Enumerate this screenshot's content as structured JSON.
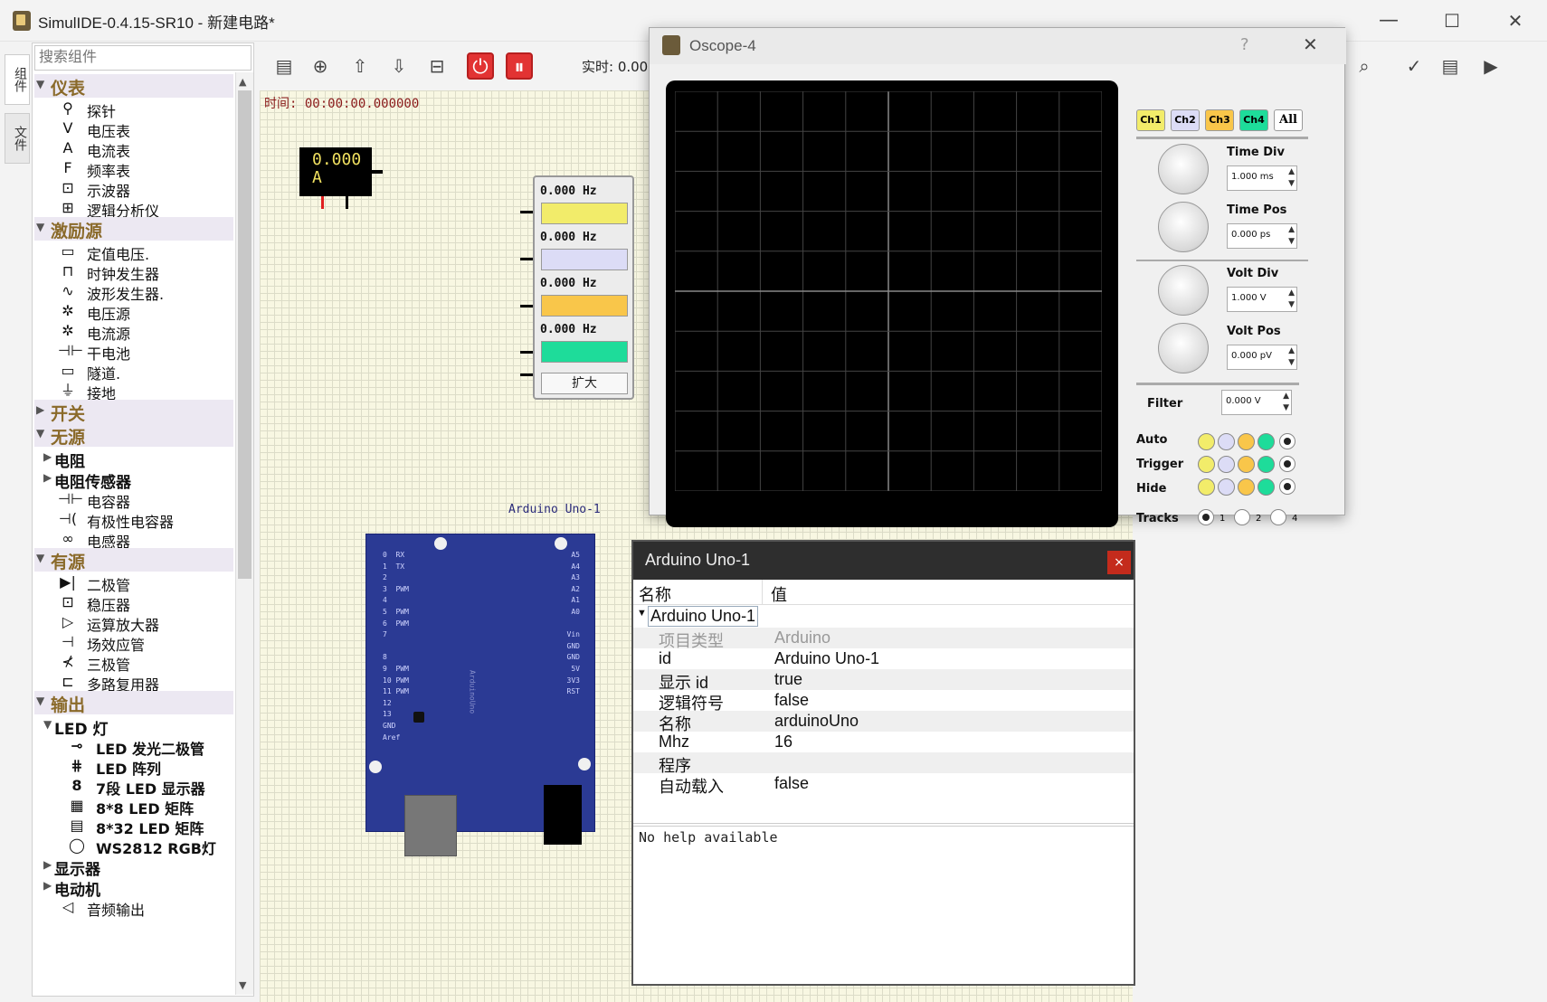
{
  "window": {
    "title": "SimulIDE-0.4.15-SR10  -  新建电路*",
    "min": "—",
    "max": "☐",
    "close": "✕"
  },
  "sidetabs": {
    "components": "组件",
    "files": "文件"
  },
  "components": {
    "search_placeholder": "搜索组件",
    "tree": [
      {
        "kind": "cat",
        "label": "仪表",
        "arrow": "▼"
      },
      {
        "kind": "item",
        "label": "探针",
        "icon": "⚲"
      },
      {
        "kind": "item",
        "label": "电压表",
        "icon": "V"
      },
      {
        "kind": "item",
        "label": "电流表",
        "icon": "A"
      },
      {
        "kind": "item",
        "label": "频率表",
        "icon": "F"
      },
      {
        "kind": "item",
        "label": "示波器",
        "icon": "⊡"
      },
      {
        "kind": "item",
        "label": "逻辑分析仪",
        "icon": "⊞"
      },
      {
        "kind": "cat",
        "label": "激励源",
        "arrow": "▼"
      },
      {
        "kind": "item",
        "label": "定值电压.",
        "icon": "▭"
      },
      {
        "kind": "item",
        "label": "时钟发生器",
        "icon": "⊓"
      },
      {
        "kind": "item",
        "label": "波形发生器.",
        "icon": "∿"
      },
      {
        "kind": "item",
        "label": "电压源",
        "icon": "✲"
      },
      {
        "kind": "item",
        "label": "电流源",
        "icon": "✲"
      },
      {
        "kind": "item",
        "label": "干电池",
        "icon": "⊣⊢"
      },
      {
        "kind": "item",
        "label": "隧道.",
        "icon": "▭"
      },
      {
        "kind": "item",
        "label": "接地",
        "icon": "⏚"
      },
      {
        "kind": "cat",
        "label": "开关",
        "arrow": "▶"
      },
      {
        "kind": "cat",
        "label": "无源",
        "arrow": "▼"
      },
      {
        "kind": "sub",
        "label": "电阻",
        "arrow": "▶"
      },
      {
        "kind": "sub",
        "label": "电阻传感器",
        "arrow": "▶"
      },
      {
        "kind": "item",
        "label": "电容器",
        "icon": "⊣⊢"
      },
      {
        "kind": "item",
        "label": "有极性电容器",
        "icon": "⊣("
      },
      {
        "kind": "item",
        "label": "电感器",
        "icon": "∞"
      },
      {
        "kind": "cat",
        "label": "有源",
        "arrow": "▼"
      },
      {
        "kind": "item",
        "label": "二极管",
        "icon": "▶|"
      },
      {
        "kind": "item",
        "label": "稳压器",
        "icon": "⊡"
      },
      {
        "kind": "item",
        "label": "运算放大器",
        "icon": "▷"
      },
      {
        "kind": "item",
        "label": "场效应管",
        "icon": "⊣"
      },
      {
        "kind": "item",
        "label": "三极管",
        "icon": "⊀"
      },
      {
        "kind": "item",
        "label": "多路复用器",
        "icon": "⊏"
      },
      {
        "kind": "cat",
        "label": "输出",
        "arrow": "▼"
      },
      {
        "kind": "sub",
        "label": "LED 灯",
        "arrow": "▼"
      },
      {
        "kind": "item2",
        "label": "LED 发光二极管",
        "icon": "⊸"
      },
      {
        "kind": "item2",
        "label": "LED 阵列",
        "icon": "⋕"
      },
      {
        "kind": "item2",
        "label": "7段 LED 显示器",
        "icon": "8"
      },
      {
        "kind": "item2",
        "label": "8*8 LED 矩阵",
        "icon": "▦"
      },
      {
        "kind": "item2",
        "label": "8*32 LED 矩阵",
        "icon": "▤"
      },
      {
        "kind": "item2",
        "label": "WS2812 RGB灯",
        "icon": "◯"
      },
      {
        "kind": "sub",
        "label": "显示器",
        "arrow": "▶"
      },
      {
        "kind": "sub",
        "label": "电动机",
        "arrow": "▶"
      },
      {
        "kind": "item",
        "label": "音频输出",
        "icon": "◁"
      }
    ]
  },
  "toolbar": {
    "realtime": "实时: 0.00 %"
  },
  "canvas": {
    "time": "时间:  00:00:00.000000",
    "ammeter_value": "0.000",
    "ammeter_unit": "A",
    "arduino_label": "Arduino Uno-1"
  },
  "freqmeter": {
    "rows": [
      "0.000 Hz",
      "0.000 Hz",
      "0.000 Hz",
      "0.000 Hz"
    ],
    "colors": [
      "#f2ec6a",
      "#dcdcf6",
      "#f9c64a",
      "#1edc9a"
    ],
    "expand": "扩大"
  },
  "arduino": {
    "left_pins": "0  RX\n1  TX\n2\n3  PWM\n4\n5  PWM\n6  PWM\n7\n\n8\n9  PWM\n10 PWM\n11 PWM\n12\n13\nGND\nAref",
    "right_pins": "A5\nA4\nA3\nA2\nA1\nA0\n\nVin\nGND\nGND\n5V\n3V3\nRST",
    "board_text": "ArduinoUno"
  },
  "oscope": {
    "title": "Oscope-4",
    "help": "?",
    "close": "✕",
    "channels": [
      "Ch1",
      "Ch2",
      "Ch3",
      "Ch4",
      "All"
    ],
    "channel_colors": [
      "#f2ec6a",
      "#dcdcf6",
      "#f9c64a",
      "#1edc9a",
      "#ffffff"
    ],
    "time_div": {
      "label": "Time Div",
      "value": "1.000 ms"
    },
    "time_pos": {
      "label": "Time Pos",
      "value": "0.000 ps"
    },
    "volt_div": {
      "label": "Volt Div",
      "value": "1.000 V"
    },
    "volt_pos": {
      "label": "Volt Pos",
      "value": "0.000 pV"
    },
    "filter": {
      "label": "Filter",
      "value": "0.000 V"
    },
    "auto": "Auto",
    "trigger": "Trigger",
    "hide": "Hide",
    "tracks": {
      "label": "Tracks",
      "options": [
        "1",
        "2",
        "4"
      ],
      "selected": "1"
    }
  },
  "props": {
    "title": "Arduino Uno-1",
    "close": "×",
    "col_name": "名称",
    "col_value": "值",
    "group": "Arduino Uno-1",
    "rows": [
      {
        "k": "项目类型",
        "v": "Arduino"
      },
      {
        "k": "id",
        "v": "Arduino Uno-1"
      },
      {
        "k": "显示 id",
        "v": "true"
      },
      {
        "k": "逻辑符号",
        "v": "false"
      },
      {
        "k": "名称",
        "v": "arduinoUno"
      },
      {
        "k": "Mhz",
        "v": "16"
      },
      {
        "k": "程序",
        "v": ""
      },
      {
        "k": "自动载入",
        "v": "false"
      }
    ],
    "help": "No help available"
  }
}
